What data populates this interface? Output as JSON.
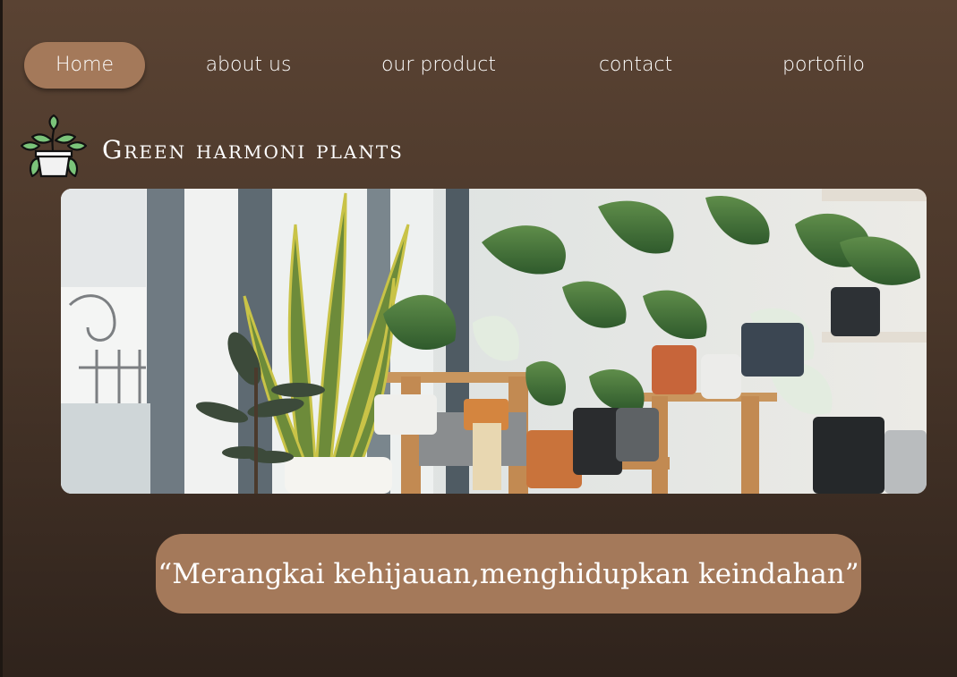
{
  "nav": {
    "items": [
      {
        "label": "Home",
        "active": true
      },
      {
        "label": "about us",
        "active": false
      },
      {
        "label": "our product",
        "active": false
      },
      {
        "label": "contact",
        "active": false
      },
      {
        "label": "portofilo",
        "active": false
      }
    ]
  },
  "brand": {
    "title": "Green harmoni plants",
    "logo_icon": "potted-plant-icon"
  },
  "hero": {
    "image": "potted-plants-shop-photo"
  },
  "quote": {
    "text": "“Merangkai kehijauan,menghidupkan keindahan”"
  },
  "colors": {
    "accent": "#a4795a",
    "background_top": "#5a4333",
    "background_bottom": "#2f231c",
    "text": "#ffffff"
  }
}
